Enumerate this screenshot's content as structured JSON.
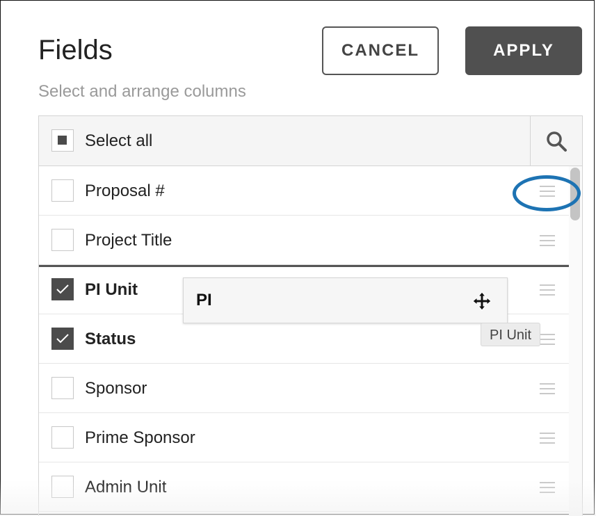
{
  "panel": {
    "title": "Fields",
    "subtitle": "Select and arrange columns",
    "cancel_label": "CANCEL",
    "apply_label": "APPLY"
  },
  "list": {
    "select_all_label": "Select all",
    "select_all_state": "indeterminate",
    "rows": [
      {
        "label": "Proposal #",
        "checked": false
      },
      {
        "label": "Project Title",
        "checked": false
      },
      {
        "label": "PI Unit",
        "checked": true
      },
      {
        "label": "Status",
        "checked": true
      },
      {
        "label": "Sponsor",
        "checked": false
      },
      {
        "label": "Prime Sponsor",
        "checked": false
      },
      {
        "label": "Admin Unit",
        "checked": false
      }
    ]
  },
  "drag": {
    "ghost_label": "PI",
    "tooltip": "PI Unit",
    "cursor_icon": "move-icon"
  },
  "annotation": {
    "highlight_color": "#1d73b3"
  }
}
